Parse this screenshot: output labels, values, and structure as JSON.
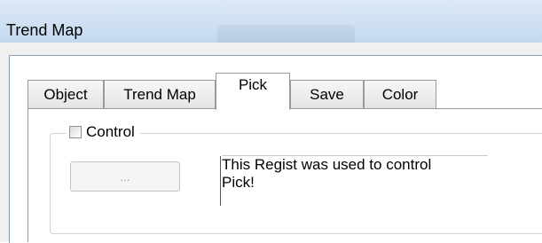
{
  "window": {
    "title": "Trend Map"
  },
  "tabs": [
    {
      "label": "Object"
    },
    {
      "label": "Trend Map"
    },
    {
      "label": "Pick"
    },
    {
      "label": "Save"
    },
    {
      "label": "Color"
    }
  ],
  "active_tab": "Pick",
  "control_group": {
    "checkbox_label": "Control",
    "checked": false,
    "browse_button_label": "...",
    "description_line1": "This Regist was used to control",
    "description_line2": "Pick!"
  }
}
